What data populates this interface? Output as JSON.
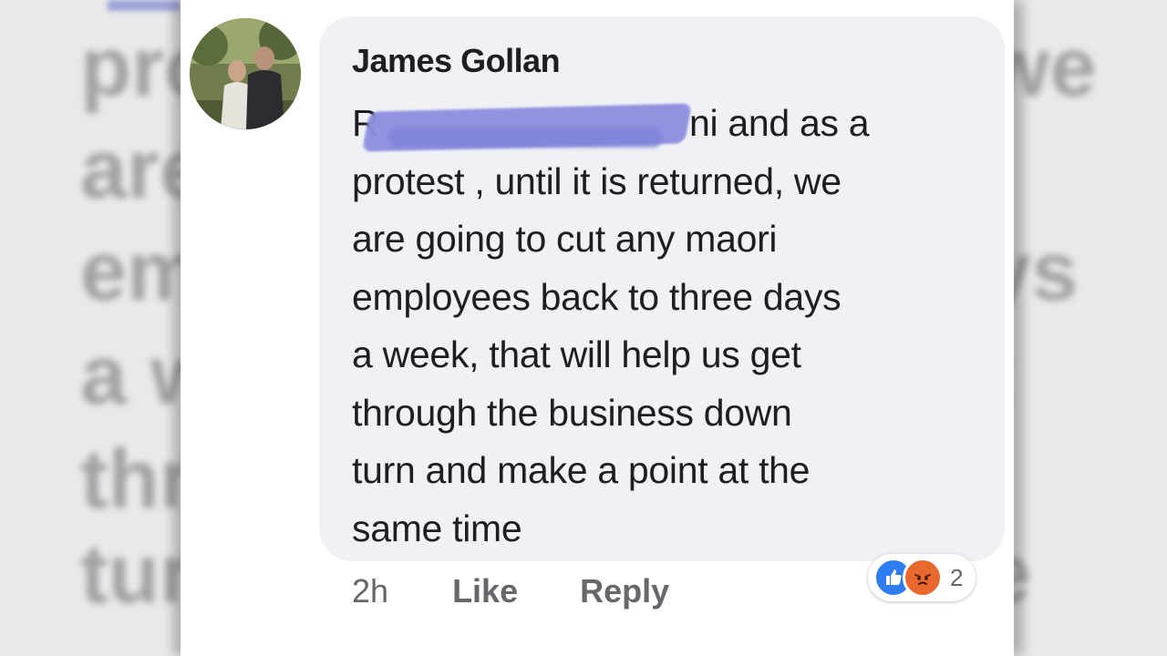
{
  "background": {
    "left_ghost_fragments": [
      "pro",
      "are",
      "em",
      "a w",
      "thr",
      "tur"
    ],
    "right_ghost_fragments": [
      "we",
      "",
      "ys",
      "t",
      "",
      "e"
    ]
  },
  "comment": {
    "author": "James Gollan",
    "lines": [
      {
        "redacted_prefix": "R",
        "text": "ni and as a"
      },
      {
        "text": "protest , until it is returned, we"
      },
      {
        "text": "are going to cut any maori"
      },
      {
        "text": "employees back to three days"
      },
      {
        "text": "a week, that will help us get"
      },
      {
        "text": "through the business down"
      },
      {
        "text": "turn and make a point at the"
      },
      {
        "text": "same time"
      }
    ],
    "redaction_color": "#8c8fe0"
  },
  "actions": {
    "time": "2h",
    "like_label": "Like",
    "reply_label": "Reply"
  },
  "reactions": {
    "icons": [
      "like-icon",
      "angry-icon"
    ],
    "like_color": "#2d7cf0",
    "angry_color": "#e8682d",
    "count": "2"
  }
}
